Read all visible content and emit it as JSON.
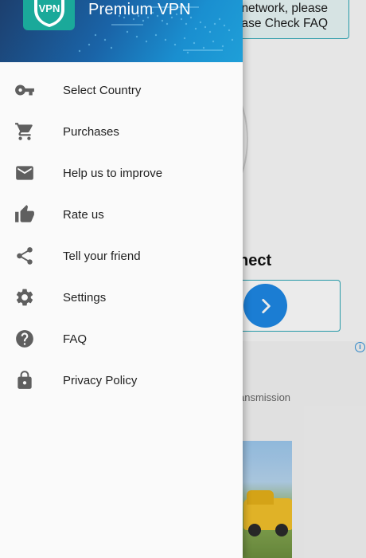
{
  "app": {
    "title": "Premium VPN",
    "logo_text": "VPN",
    "header_gradient": [
      "#1c3f6e",
      "#1a8fd0"
    ],
    "logo_color": "#1aa99a"
  },
  "drawer": {
    "items": [
      {
        "label": "Select Country",
        "icon": "key-icon"
      },
      {
        "label": "Purchases",
        "icon": "cart-icon"
      },
      {
        "label": "Help us to improve",
        "icon": "mail-icon"
      },
      {
        "label": "Rate us",
        "icon": "thumb-up-icon"
      },
      {
        "label": "Tell your friend",
        "icon": "share-icon"
      },
      {
        "label": "Settings",
        "icon": "gear-icon"
      },
      {
        "label": "FAQ",
        "icon": "help-circle-icon"
      },
      {
        "label": "Privacy Policy",
        "icon": "lock-icon"
      }
    ],
    "icon_color": "#5f5f5f"
  },
  "background": {
    "notice_lines": [
      "network, please",
      "ease Check FAQ"
    ],
    "connect_label": "nect",
    "ad_text": "ansmission",
    "ad_info_icon": "info-icon",
    "accent": "#2aa6b6",
    "button_color": "#1e88e5"
  }
}
